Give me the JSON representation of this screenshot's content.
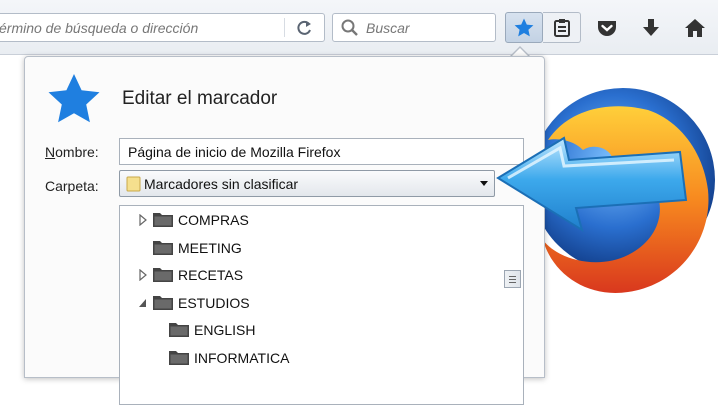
{
  "toolbar": {
    "url_placeholder": "érmino de búsqueda o dirección",
    "search_placeholder": "Buscar"
  },
  "panel": {
    "title": "Editar el marcador",
    "name_label_first": "N",
    "name_label_rest": "ombre:",
    "folder_label": "Carpeta:",
    "name_value": "Página de inicio de Mozilla Firefox",
    "folder_value": "Marcadores sin clasificar",
    "tree": [
      {
        "label": "COMPRAS",
        "expander": "collapsed",
        "level": 0
      },
      {
        "label": "MEETING",
        "expander": "none",
        "level": 0
      },
      {
        "label": "RECETAS",
        "expander": "collapsed",
        "level": 0
      },
      {
        "label": "ESTUDIOS",
        "expander": "expanded",
        "level": 0
      },
      {
        "label": "ENGLISH",
        "expander": "none",
        "level": 1
      },
      {
        "label": "INFORMATICA",
        "expander": "none",
        "level": 1
      }
    ]
  },
  "colors": {
    "star_blue": "#1f7fe0",
    "arrow_blue": "#3da9ec"
  }
}
